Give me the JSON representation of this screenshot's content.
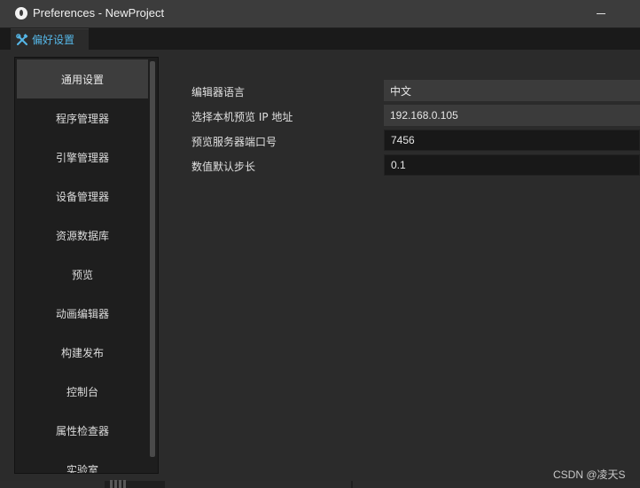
{
  "window": {
    "title": "Preferences - NewProject",
    "app_icon": "drop-logo-icon",
    "controls": {
      "minimize_icon": "minimize-icon"
    }
  },
  "tabs": [
    {
      "label": "偏好设置",
      "icon": "tools-icon",
      "active": true
    }
  ],
  "sidebar": {
    "items": [
      {
        "label": "通用设置",
        "active": true
      },
      {
        "label": "程序管理器"
      },
      {
        "label": "引擎管理器"
      },
      {
        "label": "设备管理器"
      },
      {
        "label": "资源数据库"
      },
      {
        "label": "预览"
      },
      {
        "label": "动画编辑器"
      },
      {
        "label": "构建发布"
      },
      {
        "label": "控制台"
      },
      {
        "label": "属性检查器"
      },
      {
        "label": "实验室"
      }
    ]
  },
  "preferences": [
    {
      "label": "编辑器语言",
      "value": "中文",
      "kind": "select"
    },
    {
      "label": "选择本机预览 IP 地址",
      "value": "192.168.0.105",
      "kind": "select"
    },
    {
      "label": "预览服务器端口号",
      "value": "7456",
      "kind": "input"
    },
    {
      "label": "数值默认步长",
      "value": "0.1",
      "kind": "input"
    }
  ],
  "watermark": "CSDN @凌天S",
  "colors": {
    "accent": "#55b6e6",
    "background": "#2b2b2b",
    "sidebar": "#1e1e1e",
    "active_item": "#3d3d3d"
  }
}
